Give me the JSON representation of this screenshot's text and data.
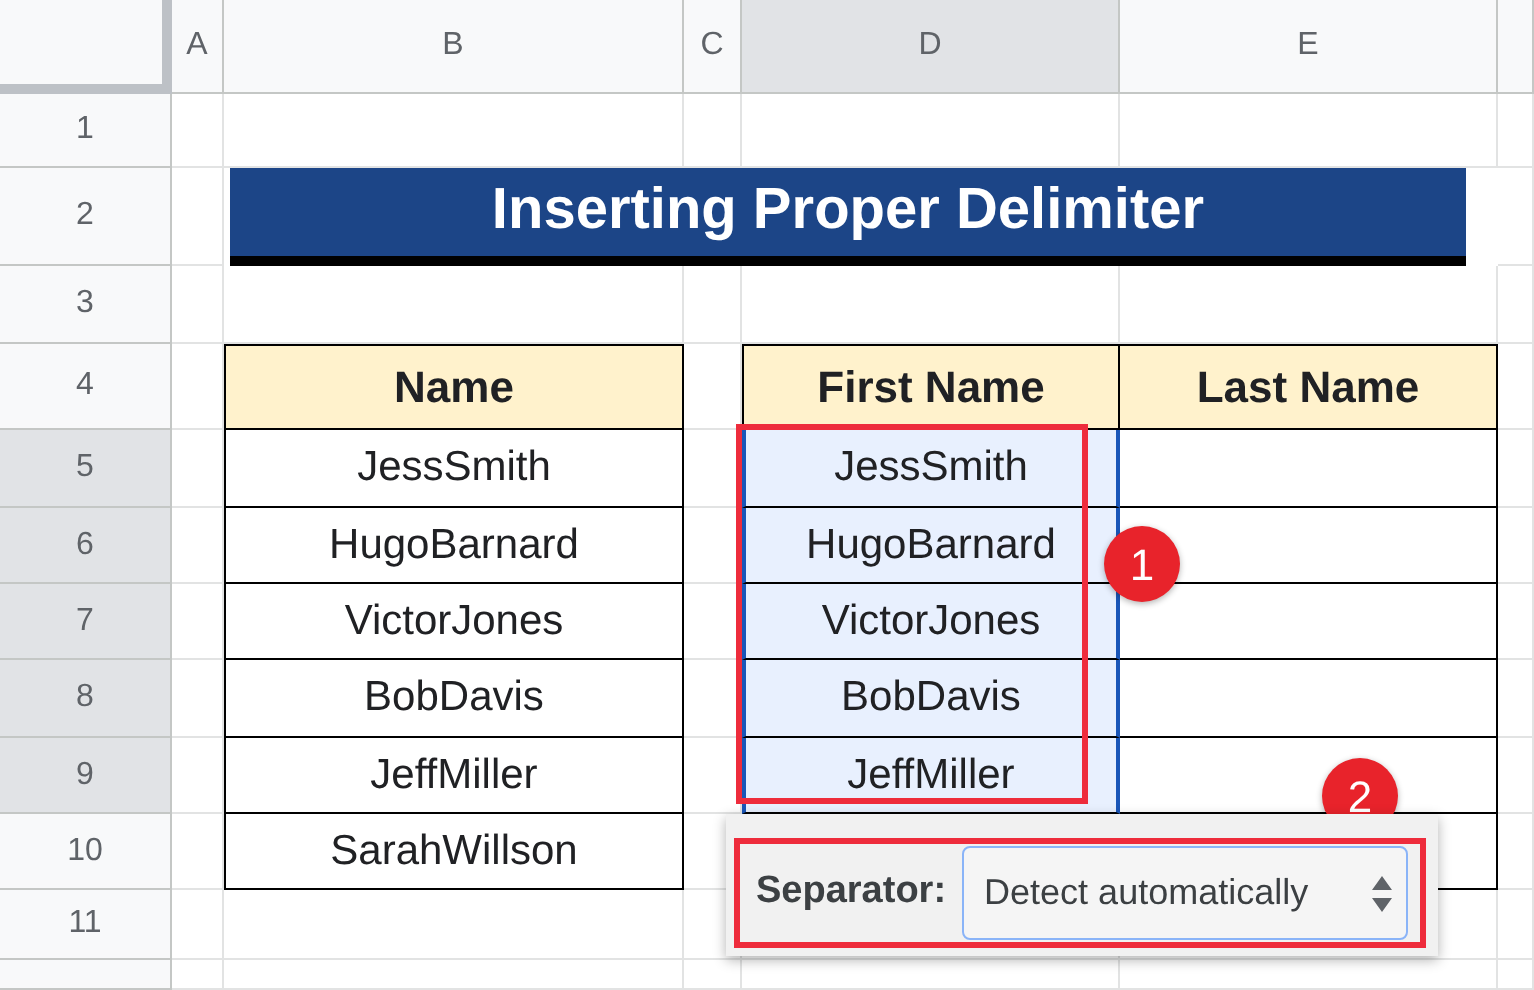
{
  "columns": [
    {
      "label": "A",
      "selected": false
    },
    {
      "label": "B",
      "selected": false
    },
    {
      "label": "C",
      "selected": false
    },
    {
      "label": "D",
      "selected": true
    },
    {
      "label": "E",
      "selected": false
    }
  ],
  "rows": [
    {
      "label": "1",
      "selected": false
    },
    {
      "label": "2",
      "selected": false
    },
    {
      "label": "3",
      "selected": false
    },
    {
      "label": "4",
      "selected": false
    },
    {
      "label": "5",
      "selected": true
    },
    {
      "label": "6",
      "selected": true
    },
    {
      "label": "7",
      "selected": true
    },
    {
      "label": "8",
      "selected": true
    },
    {
      "label": "9",
      "selected": true
    },
    {
      "label": "10",
      "selected": false
    },
    {
      "label": "11",
      "selected": false
    }
  ],
  "title": "Inserting Proper Delimiter",
  "name_table": {
    "header": "Name",
    "rows": [
      "JessSmith",
      "HugoBarnard",
      "VictorJones",
      "BobDavis",
      "JeffMiller",
      "SarahWillson"
    ]
  },
  "split_table": {
    "columns": [
      "First Name",
      "Last Name"
    ],
    "rows": [
      {
        "first": "JessSmith",
        "selected": true
      },
      {
        "first": "HugoBarnard",
        "selected": true
      },
      {
        "first": "VictorJones",
        "selected": true
      },
      {
        "first": "BobDavis",
        "selected": true
      },
      {
        "first": "JeffMiller",
        "selected": true
      }
    ]
  },
  "separator": {
    "label": "Separator:",
    "value": "Detect automatically"
  },
  "callouts": [
    "1",
    "2"
  ]
}
